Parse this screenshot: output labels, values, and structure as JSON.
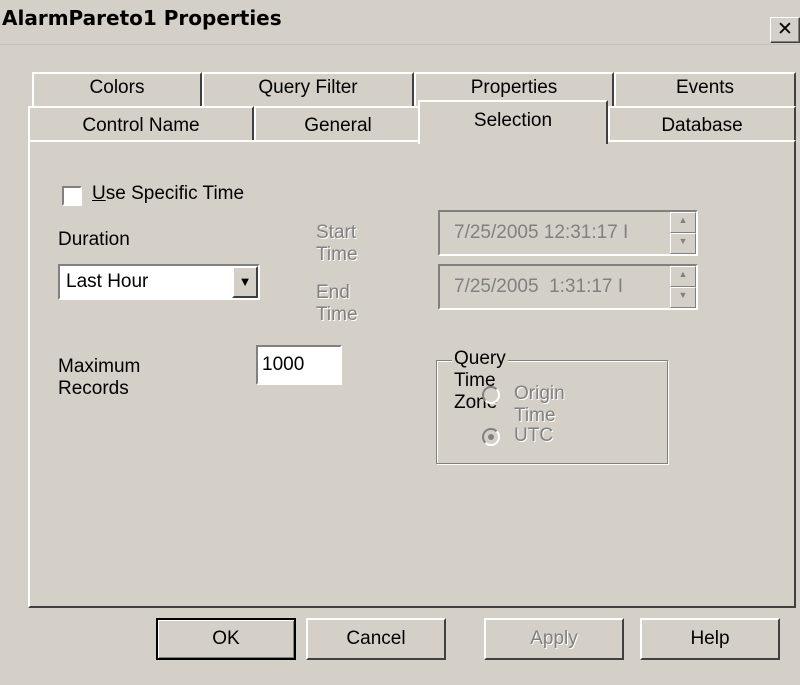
{
  "window": {
    "title": "AlarmPareto1 Properties",
    "close_glyph": "✕"
  },
  "tabs_back": [
    "Colors",
    "Query Filter",
    "Properties",
    "Events"
  ],
  "tabs_front": [
    "Control Name",
    "General",
    "Selection",
    "Database"
  ],
  "selection": {
    "use_specific_time": {
      "label": "Use Specific Time",
      "checked": false
    },
    "duration": {
      "label": "Duration",
      "value": "Last Hour"
    },
    "start_time": {
      "label": "Start Time",
      "value": "7/25/2005 12:31:17 I"
    },
    "end_time": {
      "label": "End Time",
      "value": "7/25/2005  1:31:17 I"
    },
    "max_records": {
      "label": "Maximum Records",
      "value": "1000"
    },
    "time_zone": {
      "label": "Query Time Zone",
      "options": [
        {
          "label": "Origin Time",
          "selected": false
        },
        {
          "label": "UTC",
          "selected": true
        }
      ]
    }
  },
  "buttons": {
    "ok": "OK",
    "cancel": "Cancel",
    "apply": "Apply",
    "help": "Help"
  }
}
